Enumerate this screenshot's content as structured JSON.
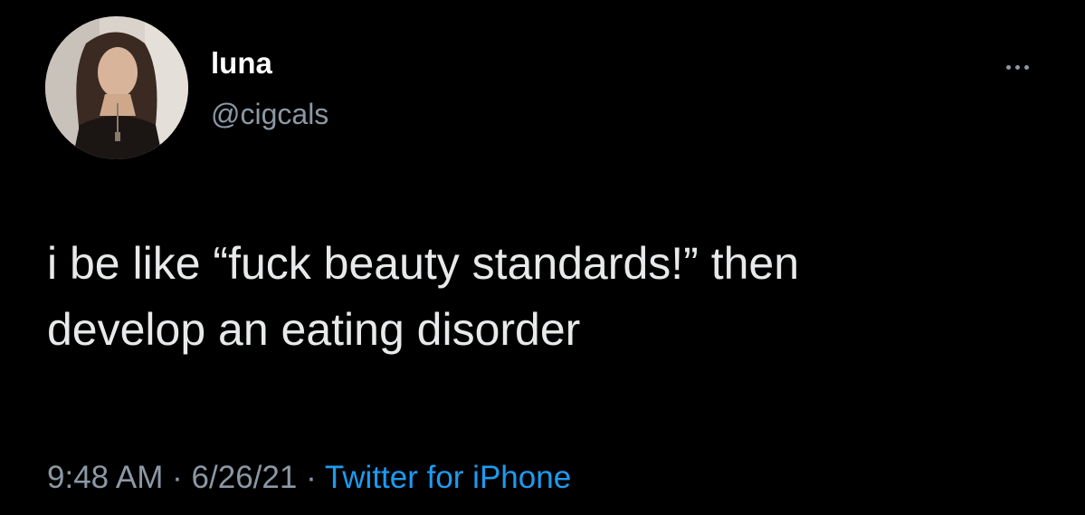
{
  "tweet": {
    "author": {
      "display_name": "luna",
      "handle": "@cigcals"
    },
    "more_icon": "more-horizontal-icon",
    "text_lines": [
      "i be like “fuck beauty standards!” then",
      "develop an eating disorder"
    ],
    "time": "9:48 AM",
    "separator": "·",
    "date": "6/26/21",
    "source": "Twitter for iPhone"
  },
  "colors": {
    "background": "#000000",
    "text_primary": "#e7e9ea",
    "text_secondary": "#8b98a5",
    "link_accent": "#1d9bf0"
  }
}
